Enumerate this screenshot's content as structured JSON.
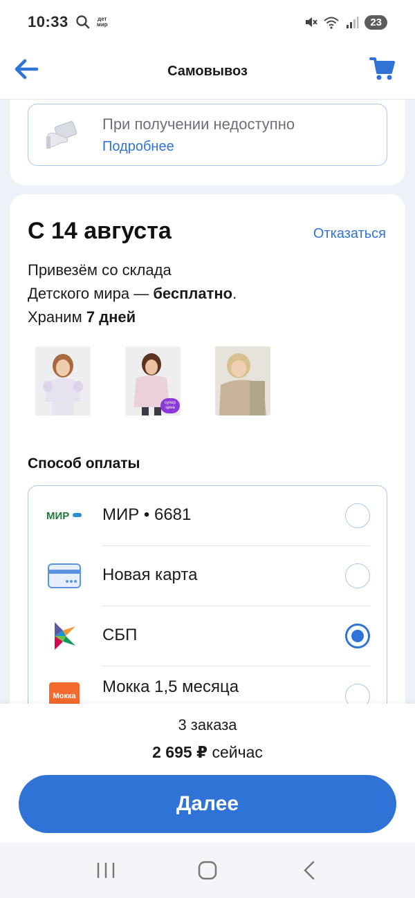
{
  "status_bar": {
    "time": "10:33",
    "app_logo_text": "дет мир",
    "battery": "23"
  },
  "header": {
    "title": "Самовывоз",
    "back_icon": "arrow-left-icon",
    "cart_icon": "cart-icon"
  },
  "unavailable": {
    "text": "При получении недоступно",
    "link": "Подробнее",
    "icon": "card-hand-icon"
  },
  "delivery": {
    "date": "С 14 августа",
    "cancel_label": "Отказаться",
    "line1": "Привезём со склада",
    "line2_prefix": "Детского мира — ",
    "line2_bold": "бесплатно",
    "line2_suffix": ".",
    "line3_prefix": "Храним ",
    "line3_bold": "7 дней",
    "badge_text": "супер цена"
  },
  "payment": {
    "title": "Способ оплаты",
    "options": [
      {
        "label": "МИР • 6681",
        "icon": "mir-logo-icon",
        "selected": false
      },
      {
        "label": "Новая карта",
        "icon": "credit-card-icon",
        "selected": false
      },
      {
        "label": "СБП",
        "icon": "sbp-logo-icon",
        "selected": true
      },
      {
        "label": "Мокка 1,5 месяца",
        "icon": "mokka-logo-icon",
        "selected": false,
        "logo_text": "Мокка"
      }
    ]
  },
  "summary": {
    "orders": "3 заказа",
    "total_bold": "2 695 ₽",
    "total_suffix": " сейчас",
    "next_label": "Далее"
  },
  "colors": {
    "accent": "#2f73d6",
    "border": "#a9c8ee",
    "background": "#eef2f8"
  }
}
